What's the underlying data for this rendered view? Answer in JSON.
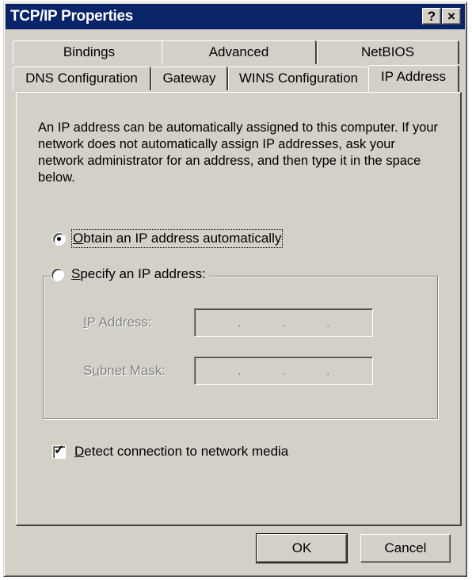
{
  "window": {
    "title": "TCP/IP Properties",
    "help_label": "?",
    "close_label": "×"
  },
  "tabs": {
    "row1": [
      "Bindings",
      "Advanced",
      "NetBIOS"
    ],
    "row2": [
      "DNS Configuration",
      "Gateway",
      "WINS Configuration",
      "IP Address"
    ],
    "selected": "IP Address"
  },
  "description": "An IP address can be automatically assigned to this computer. If your network does not automatically assign IP addresses, ask your network administrator for an address, and then type it in the space below.",
  "options": {
    "obtain_auto": {
      "mnemonic": "O",
      "rest": "btain an IP address automatically",
      "selected": true
    },
    "specify": {
      "mnemonic": "S",
      "rest": "pecify an IP address:",
      "selected": false
    }
  },
  "fields": {
    "ip_address": {
      "mnemonic": "I",
      "rest": "P Address:",
      "octets": [
        "",
        "",
        "",
        ""
      ],
      "separator": "."
    },
    "subnet_mask": {
      "pre": "S",
      "mnemonic": "u",
      "rest": "bnet Mask:",
      "octets": [
        "",
        "",
        "",
        ""
      ],
      "separator": "."
    }
  },
  "detect_media": {
    "mnemonic": "D",
    "rest": "etect connection to network media",
    "checked": true,
    "check_glyph": "✓"
  },
  "buttons": {
    "ok": "OK",
    "cancel": "Cancel"
  }
}
